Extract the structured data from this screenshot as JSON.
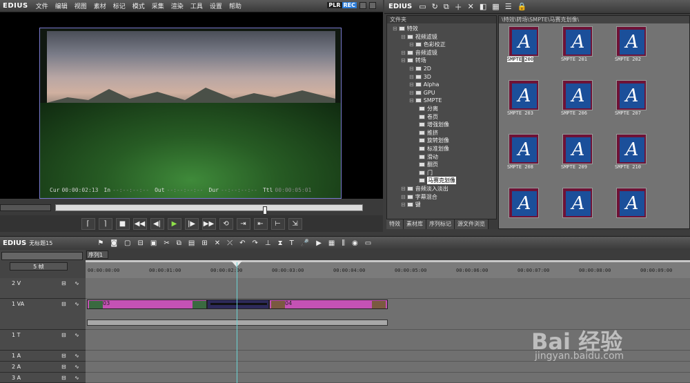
{
  "app": {
    "logo": "EDIUS"
  },
  "menu": [
    "文件",
    "编辑",
    "视图",
    "素材",
    "标记",
    "模式",
    "采集",
    "渲染",
    "工具",
    "设置",
    "帮助"
  ],
  "player": {
    "mode_plr": "PLR",
    "mode_rec": "REC",
    "timecodes": [
      {
        "label": "Cur",
        "value": "00:00:02:13"
      },
      {
        "label": "In",
        "value": "--:--:--:--"
      },
      {
        "label": "Out",
        "value": "--:--:--:--"
      },
      {
        "label": "Dur",
        "value": "--:--:--:--"
      },
      {
        "label": "Ttl",
        "value": "00:00:05:01"
      }
    ]
  },
  "right_pane": {
    "logo": "EDIUS",
    "tree_header": "文件夹",
    "bin_path": "\\特效\\转场\\SMPTE\\马赛克划像\\",
    "tree": [
      {
        "label": "特效",
        "level": 0
      },
      {
        "label": "视频滤镜",
        "level": 1
      },
      {
        "label": "色彩校正",
        "level": 2
      },
      {
        "label": "音频滤镜",
        "level": 1
      },
      {
        "label": "转场",
        "level": 1
      },
      {
        "label": "2D",
        "level": 2
      },
      {
        "label": "3D",
        "level": 2
      },
      {
        "label": "Alpha",
        "level": 2
      },
      {
        "label": "GPU",
        "level": 2
      },
      {
        "label": "SMPTE",
        "level": 2
      },
      {
        "label": "分离",
        "level": 3
      },
      {
        "label": "卷页",
        "level": 3
      },
      {
        "label": "增强划像",
        "level": 3
      },
      {
        "label": "推挤",
        "level": 3
      },
      {
        "label": "旋转划像",
        "level": 3
      },
      {
        "label": "标准划像",
        "level": 3
      },
      {
        "label": "滑动",
        "level": 3
      },
      {
        "label": "翻页",
        "level": 3
      },
      {
        "label": "门",
        "level": 3
      },
      {
        "label": "马赛克划像",
        "level": 3
      },
      {
        "label": "音频淡入淡出",
        "level": 1
      },
      {
        "label": "字幕混合",
        "level": 1
      },
      {
        "label": "键",
        "level": 1
      }
    ],
    "selected_tree": "马赛克划像",
    "clips": [
      {
        "label": "SMPTE",
        "num": "200",
        "selected": true
      },
      {
        "label": "SMPTE",
        "num": "201"
      },
      {
        "label": "SMPTE",
        "num": "202"
      },
      {
        "label": "SMPTE",
        "num": "203"
      },
      {
        "label": "SMPTE",
        "num": "206"
      },
      {
        "label": "SMPTE",
        "num": "207"
      },
      {
        "label": "SMPTE",
        "num": "208"
      },
      {
        "label": "SMPTE",
        "num": "209"
      },
      {
        "label": "SMPTE",
        "num": "210"
      },
      {
        "label": "",
        "num": ""
      },
      {
        "label": "",
        "num": ""
      },
      {
        "label": "",
        "num": ""
      }
    ],
    "tabs": [
      "特效",
      "素材库",
      "序列标记",
      "源文件浏览"
    ]
  },
  "timeline": {
    "logo": "EDIUS",
    "project": "无标题15",
    "sequence_tab": "序列1",
    "zoom": "5 帧",
    "ruler": [
      "00:00:00:00",
      "00:00:01:00",
      "00:00:02:00",
      "00:00:03:00",
      "00:00:04:00",
      "00:00:05:00",
      "00:00:06:00",
      "00:00:07:00",
      "00:00:08:00",
      "00:00:09:00"
    ],
    "tracks": [
      {
        "name": "2 V"
      },
      {
        "name": "1 VA"
      },
      {
        "name": "1 T"
      },
      {
        "name": "1 A"
      },
      {
        "name": "2 A"
      },
      {
        "name": "3 A"
      }
    ],
    "clips": {
      "clip1": "03",
      "clip2": "04"
    }
  },
  "watermark": {
    "brand": "Bai 经验",
    "url": "jingyan.baidu.com"
  }
}
